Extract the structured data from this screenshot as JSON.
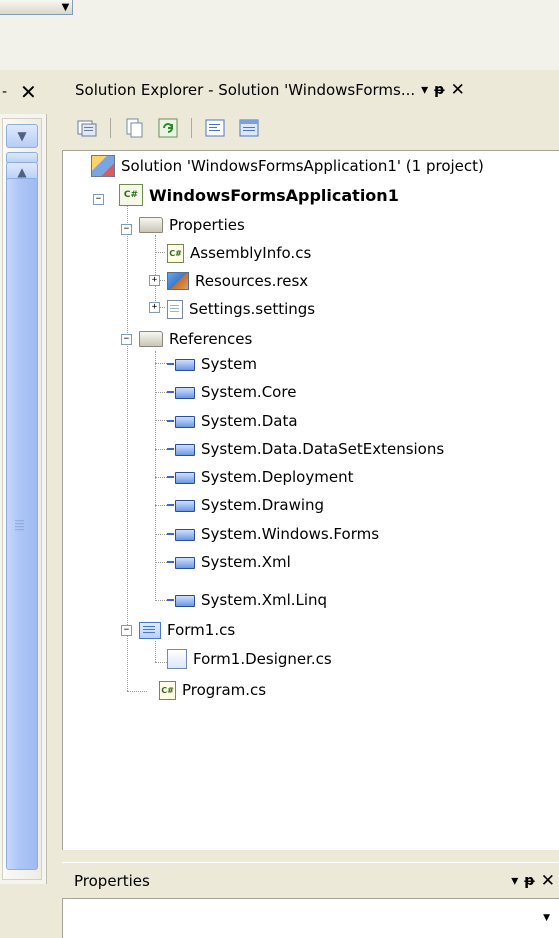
{
  "top": {
    "combo_arrow_icon": "chevron-down"
  },
  "left_panel": {
    "close_glyph": "✕",
    "dash_glyph": "-"
  },
  "solution_explorer": {
    "title": "Solution Explorer - Solution 'WindowsForms...",
    "dropdown_glyph": "▾",
    "pin_glyph": "ᵽ",
    "close_glyph": "✕",
    "toolbar": [
      "properties-icon",
      "show-all-files-icon",
      "refresh-icon",
      "view-code-icon",
      "view-designer-icon"
    ],
    "tree": [
      {
        "label": "Solution 'WindowsFormsApplication1' (1 project)",
        "icon": "solution-icon",
        "level": 0
      },
      {
        "label": "WindowsFormsApplication1",
        "icon": "csharp-project-icon",
        "level": 1,
        "expanded": true,
        "bold": true
      },
      {
        "label": "Properties",
        "icon": "folder-icon",
        "level": 2,
        "expanded": true
      },
      {
        "label": "AssemblyInfo.cs",
        "icon": "csharp-file-icon",
        "level": 3
      },
      {
        "label": "Resources.resx",
        "icon": "resx-icon",
        "level": 3,
        "expanded": false
      },
      {
        "label": "Settings.settings",
        "icon": "settings-file-icon",
        "level": 3,
        "expanded": false
      },
      {
        "label": "References",
        "icon": "folder-icon",
        "level": 2,
        "expanded": true
      },
      {
        "label": "System",
        "icon": "reference-icon",
        "level": 3
      },
      {
        "label": "System.Core",
        "icon": "reference-icon",
        "level": 3
      },
      {
        "label": "System.Data",
        "icon": "reference-icon",
        "level": 3
      },
      {
        "label": "System.Data.DataSetExtensions",
        "icon": "reference-icon",
        "level": 3
      },
      {
        "label": "System.Deployment",
        "icon": "reference-icon",
        "level": 3
      },
      {
        "label": "System.Drawing",
        "icon": "reference-icon",
        "level": 3
      },
      {
        "label": "System.Windows.Forms",
        "icon": "reference-icon",
        "level": 3
      },
      {
        "label": "System.Xml",
        "icon": "reference-icon",
        "level": 3
      },
      {
        "label": "System.Xml.Linq",
        "icon": "reference-icon",
        "level": 3
      },
      {
        "label": "Form1.cs",
        "icon": "form-icon",
        "level": 2,
        "expanded": true
      },
      {
        "label": "Form1.Designer.cs",
        "icon": "designer-file-icon",
        "level": 3
      },
      {
        "label": "Program.cs",
        "icon": "csharp-file-icon",
        "level": 2
      }
    ]
  },
  "properties_panel": {
    "title": "Properties",
    "dropdown_glyph": "▾",
    "pin_glyph": "ᵽ",
    "close_glyph": "✕"
  }
}
